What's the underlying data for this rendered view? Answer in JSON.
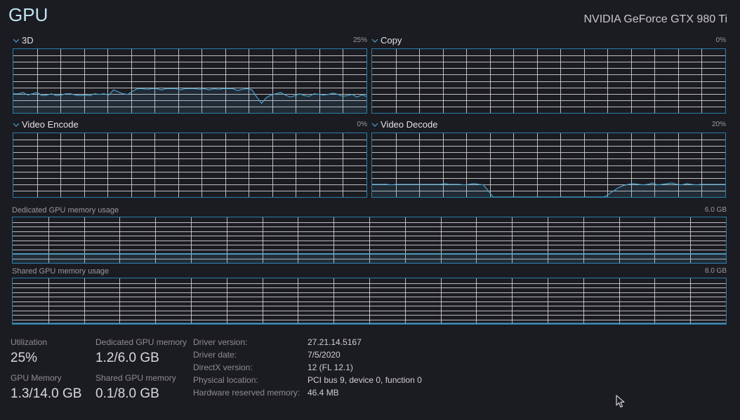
{
  "header": {
    "title": "GPU",
    "device_name": "NVIDIA GeForce GTX 980 Ti"
  },
  "engines": [
    {
      "id": "3d",
      "label": "3D",
      "percent": "25%",
      "values": [
        0.3,
        0.3,
        0.32,
        0.28,
        0.3,
        0.32,
        0.27,
        0.28,
        0.3,
        0.27,
        0.28,
        0.3,
        0.3,
        0.28,
        0.27,
        0.28,
        0.27,
        0.3,
        0.29,
        0.3,
        0.28,
        0.36,
        0.33,
        0.3,
        0.29,
        0.34,
        0.38,
        0.38,
        0.37,
        0.38,
        0.38,
        0.36,
        0.38,
        0.38,
        0.38,
        0.36,
        0.38,
        0.38,
        0.38,
        0.37,
        0.38,
        0.36,
        0.38,
        0.37,
        0.38,
        0.38,
        0.38,
        0.35,
        0.37,
        0.38,
        0.36,
        0.25,
        0.15,
        0.24,
        0.28,
        0.3,
        0.32,
        0.28,
        0.25,
        0.27,
        0.3,
        0.27,
        0.26,
        0.3,
        0.29,
        0.28,
        0.29,
        0.31,
        0.29,
        0.26,
        0.27,
        0.29,
        0.25,
        0.28,
        0.26
      ]
    },
    {
      "id": "copy",
      "label": "Copy",
      "percent": "0%",
      "values": []
    },
    {
      "id": "video-encode",
      "label": "Video Encode",
      "percent": "0%",
      "values": []
    },
    {
      "id": "video-decode",
      "label": "Video Decode",
      "percent": "20%",
      "values": [
        0.2,
        0.2,
        0.2,
        0.2,
        0.19,
        0.2,
        0.2,
        0.2,
        0.2,
        0.2,
        0.2,
        0.2,
        0.2,
        0.2,
        0.2,
        0.21,
        0.2,
        0.2,
        0.2,
        0.19,
        0.2,
        0.21,
        0.2,
        0.19,
        0.1,
        0.0,
        0.0,
        0.0,
        0.0,
        0.0,
        0.0,
        0.0,
        0.0,
        0.0,
        0.0,
        0.0,
        0.0,
        0.0,
        0.0,
        0.0,
        0.0,
        0.0,
        0.0,
        0.0,
        0.0,
        0.0,
        0.0,
        0.0,
        0.0,
        0.05,
        0.1,
        0.15,
        0.18,
        0.2,
        0.21,
        0.2,
        0.19,
        0.2,
        0.22,
        0.19,
        0.2,
        0.21,
        0.22,
        0.2,
        0.19,
        0.21,
        0.2,
        0.19,
        0.2,
        0.2,
        0.2,
        0.2,
        0.2,
        0.2
      ]
    }
  ],
  "memory_graphs": [
    {
      "id": "dedicated",
      "label": "Dedicated GPU memory usage",
      "max": "6.0 GB",
      "level": 0.2
    },
    {
      "id": "shared",
      "label": "Shared GPU memory usage",
      "max": "8.0 GB",
      "level": 0.0125
    }
  ],
  "stats": {
    "utilization": {
      "label": "Utilization",
      "value": "25%"
    },
    "dedicated_memory": {
      "label": "Dedicated GPU memory",
      "value": "1.2/6.0 GB"
    },
    "gpu_memory": {
      "label": "GPU Memory",
      "value": "1.3/14.0 GB"
    },
    "shared_memory": {
      "label": "Shared GPU memory",
      "value": "0.1/8.0 GB"
    }
  },
  "info": {
    "driver_version": {
      "label": "Driver version:",
      "value": "27.21.14.5167"
    },
    "driver_date": {
      "label": "Driver date:",
      "value": "7/5/2020"
    },
    "directx_version": {
      "label": "DirectX version:",
      "value": "12 (FL 12.1)"
    },
    "physical_location": {
      "label": "Physical location:",
      "value": "PCI bus 9, device 0, function 0"
    },
    "hardware_reserved": {
      "label": "Hardware reserved memory:",
      "value": "46.4 MB"
    }
  },
  "colors": {
    "background": "#1b1b22",
    "graph_border": "#2a7fa8",
    "grid": "#d8d8d8",
    "line": "#4aa3cc"
  }
}
